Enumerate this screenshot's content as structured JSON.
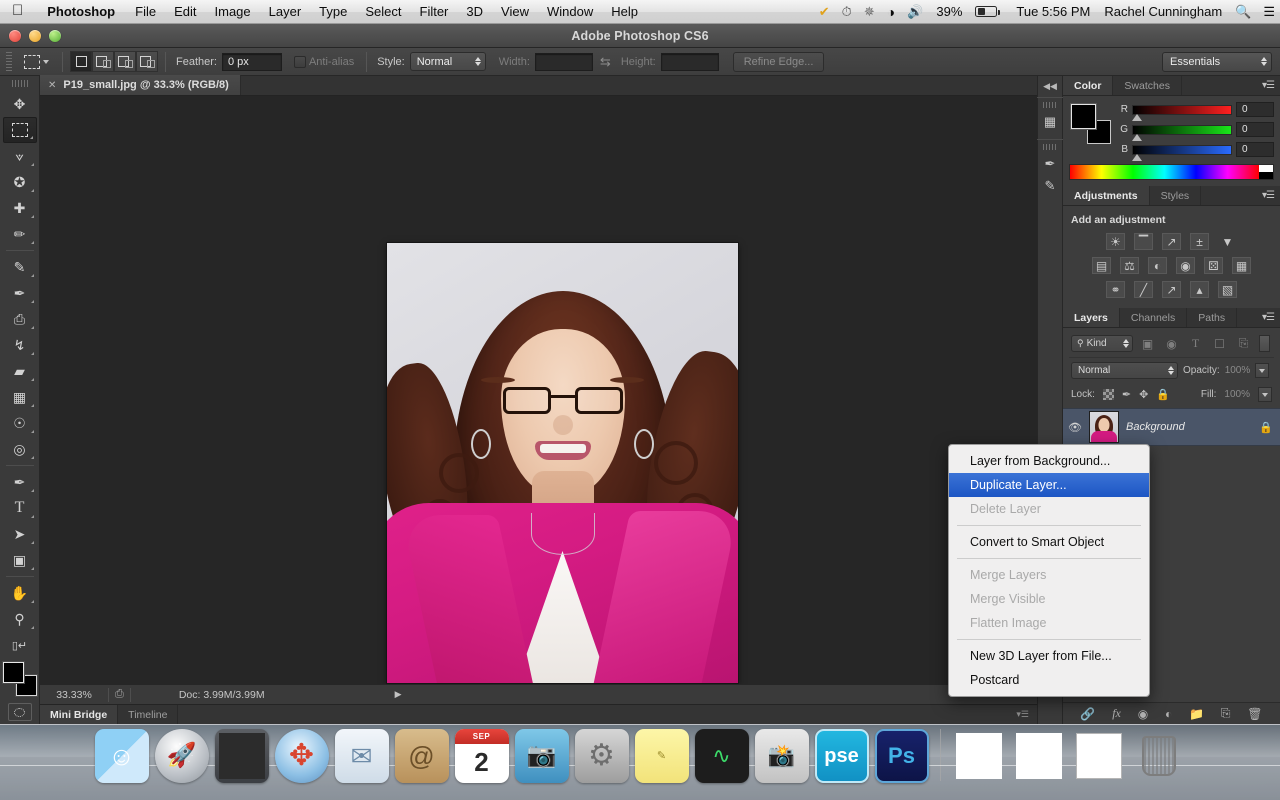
{
  "menubar": {
    "apple_icon": "apple-logo",
    "app_name": "Photoshop",
    "items": [
      "File",
      "Edit",
      "Image",
      "Layer",
      "Type",
      "Select",
      "Filter",
      "3D",
      "View",
      "Window",
      "Help"
    ],
    "status": {
      "checkmark_icon": "checkmark-icon",
      "clock_history_icon": "time-machine-icon",
      "bluetooth_icon": "bluetooth-icon",
      "wifi_icon": "wifi-icon",
      "volume_icon": "volume-icon",
      "battery_percent": "39%",
      "battery_icon": "battery-icon",
      "datetime": "Tue 5:56 PM",
      "user": "Rachel Cunningham",
      "search_icon": "spotlight-search-icon",
      "notification_icon": "notification-center-icon"
    }
  },
  "window": {
    "title": "Adobe Photoshop CS6"
  },
  "options_bar": {
    "tool_icon": "rectangular-marquee-icon",
    "selection_modes": [
      "new-selection",
      "add-to-selection",
      "subtract-from-selection",
      "intersect-selection"
    ],
    "feather_label": "Feather:",
    "feather_value": "0 px",
    "antialias_label": "Anti-alias",
    "style_label": "Style:",
    "style_value": "Normal",
    "width_label": "Width:",
    "width_value": "",
    "swap_icon": "swap-dimensions-icon",
    "height_label": "Height:",
    "height_value": "",
    "refine_edge_label": "Refine Edge...",
    "workspace_value": "Essentials"
  },
  "toolbox": {
    "tools_top": [
      {
        "name": "move-tool",
        "glyph": "✥"
      },
      {
        "name": "rectangular-marquee-tool",
        "glyph": "▭",
        "selected": true
      },
      {
        "name": "lasso-tool",
        "glyph": "✇"
      },
      {
        "name": "quick-selection-tool",
        "glyph": "✦"
      },
      {
        "name": "crop-tool",
        "glyph": "✛"
      },
      {
        "name": "eyedropper-tool",
        "glyph": "✎"
      }
    ],
    "tools_mid": [
      {
        "name": "spot-healing-brush-tool",
        "glyph": "✐"
      },
      {
        "name": "brush-tool",
        "glyph": "🖌"
      },
      {
        "name": "clone-stamp-tool",
        "glyph": "⎙"
      },
      {
        "name": "history-brush-tool",
        "glyph": "↯"
      },
      {
        "name": "eraser-tool",
        "glyph": "▰"
      },
      {
        "name": "gradient-tool",
        "glyph": "▦"
      },
      {
        "name": "blur-tool",
        "glyph": "💧"
      },
      {
        "name": "dodge-tool",
        "glyph": "◍"
      }
    ],
    "tools_bottom": [
      {
        "name": "pen-tool",
        "glyph": "✒"
      },
      {
        "name": "horizontal-type-tool",
        "glyph": "T"
      },
      {
        "name": "path-selection-tool",
        "glyph": "➤"
      },
      {
        "name": "rectangle-shape-tool",
        "glyph": "▭"
      }
    ],
    "tools_nav": [
      {
        "name": "hand-tool",
        "glyph": "✋"
      },
      {
        "name": "zoom-tool",
        "glyph": "⚲"
      }
    ],
    "foreground_color": "#000000",
    "background_color": "#000000",
    "quick_mask_name": "quick-mask-mode"
  },
  "document": {
    "tab_title": "P19_small.jpg @ 33.3% (RGB/8)",
    "close_glyph": "✕",
    "image_alt": "portrait of a smiling woman with curly auburn hair, dark glasses and a magenta blazer"
  },
  "status_bar": {
    "zoom": "33.33%",
    "doc_icon": "document-info-icon",
    "doc_size": "Doc: 3.99M/3.99M",
    "expand_glyph": "▶"
  },
  "bottom_tabs": {
    "items": [
      "Mini Bridge",
      "Timeline"
    ],
    "active": "Mini Bridge"
  },
  "right_rail": {
    "collapse_glyph": "◀◀",
    "icons": [
      "3d-panel-icon",
      "brush-presets-icon",
      "tool-presets-icon"
    ]
  },
  "color_panel": {
    "tabs": [
      "Color",
      "Swatches"
    ],
    "active_tab": "Color",
    "menu_glyph": "▾☰",
    "channels": [
      {
        "label": "R",
        "value": "0"
      },
      {
        "label": "G",
        "value": "0"
      },
      {
        "label": "B",
        "value": "0"
      }
    ],
    "foreground_color": "#000000",
    "background_color": "#000000"
  },
  "adjustments_panel": {
    "tabs": [
      "Adjustments",
      "Styles"
    ],
    "active_tab": "Adjustments",
    "menu_glyph": "▾☰",
    "heading": "Add an adjustment",
    "row1": [
      "brightness-contrast-icon",
      "levels-icon",
      "curves-icon",
      "exposure-icon",
      "vibrance-icon"
    ],
    "row2": [
      "hue-saturation-icon",
      "color-balance-icon",
      "black-white-icon",
      "photo-filter-icon",
      "channel-mixer-icon",
      "color-lookup-icon"
    ],
    "row3": [
      "invert-icon",
      "posterize-icon",
      "threshold-icon",
      "gradient-map-icon",
      "selective-color-icon"
    ]
  },
  "layers_panel": {
    "tabs": [
      "Layers",
      "Channels",
      "Paths"
    ],
    "active_tab": "Layers",
    "menu_glyph": "▾☰",
    "filter": {
      "search_icon": "search-icon",
      "kind_value": "Kind",
      "type_icons": [
        "pixel-layer-filter-icon",
        "adjustment-layer-filter-icon",
        "type-layer-filter-icon",
        "shape-layer-filter-icon",
        "smart-object-filter-icon"
      ],
      "toggle_name": "filter-toggle"
    },
    "blend_mode": "Normal",
    "opacity_label": "Opacity:",
    "opacity_value": "100%",
    "lock_label": "Lock:",
    "lock_icons": [
      "lock-transparency-icon",
      "lock-image-pixels-icon",
      "lock-position-icon",
      "lock-all-icon"
    ],
    "fill_label": "Fill:",
    "fill_value": "100%",
    "layers": [
      {
        "name": "Background",
        "locked": true,
        "selected": true,
        "eye_glyph": "👁"
      }
    ],
    "bottom_icons": [
      "link-layers-icon",
      "layer-style-fx-icon",
      "add-layer-mask-icon",
      "new-adjustment-layer-icon",
      "new-group-icon",
      "new-layer-icon",
      "delete-layer-icon"
    ]
  },
  "context_menu": {
    "items": [
      {
        "label": "Layer from Background...",
        "state": "normal"
      },
      {
        "label": "Duplicate Layer...",
        "state": "highlighted"
      },
      {
        "label": "Delete Layer",
        "state": "disabled"
      },
      {
        "separator_after": true
      },
      {
        "label": "Convert to Smart Object",
        "state": "normal"
      },
      {
        "separator_after": true
      },
      {
        "label": "Merge Layers",
        "state": "disabled"
      },
      {
        "label": "Merge Visible",
        "state": "disabled"
      },
      {
        "label": "Flatten Image",
        "state": "disabled"
      },
      {
        "separator_after": true
      },
      {
        "label": "New 3D Layer from File...",
        "state": "normal"
      },
      {
        "label": "Postcard",
        "state": "normal"
      }
    ]
  },
  "dock": {
    "items": [
      {
        "name": "finder",
        "glyph": ""
      },
      {
        "name": "launchpad",
        "glyph": "🚀"
      },
      {
        "name": "mission-control",
        "glyph": ""
      },
      {
        "name": "safari",
        "glyph": ""
      },
      {
        "name": "mail",
        "glyph": ""
      },
      {
        "name": "contacts",
        "glyph": "@"
      },
      {
        "name": "calendar",
        "month": "SEP",
        "day": "2"
      },
      {
        "name": "photo-booth",
        "glyph": ""
      },
      {
        "name": "system-preferences",
        "glyph": "⚙"
      },
      {
        "name": "stickies",
        "glyph": ""
      },
      {
        "name": "activity-monitor",
        "glyph": ""
      },
      {
        "name": "iphoto",
        "glyph": ""
      },
      {
        "name": "photoshop-elements",
        "glyph": "pse"
      },
      {
        "name": "photoshop",
        "glyph": "Ps"
      },
      {
        "name": "document-newspaper",
        "glyph": ""
      },
      {
        "name": "document-news",
        "glyph": ""
      },
      {
        "name": "document-window",
        "glyph": ""
      },
      {
        "name": "trash",
        "glyph": ""
      }
    ]
  }
}
